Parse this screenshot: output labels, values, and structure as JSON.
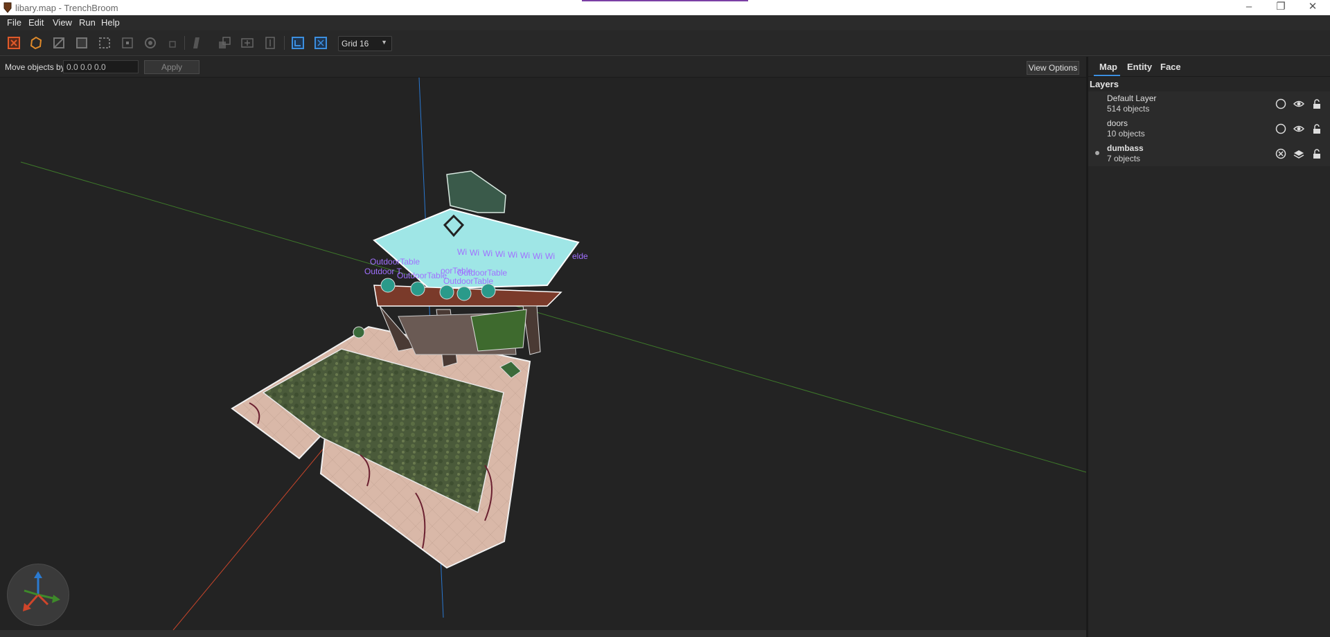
{
  "window": {
    "title": "libary.map - TrenchBroom",
    "min_label": "–",
    "max_label": "❐",
    "close_label": "✕"
  },
  "menu": {
    "items": [
      "File",
      "Edit",
      "View",
      "Run",
      "Help"
    ]
  },
  "toolbar": {
    "tools": [
      "select-tool-icon",
      "vertex-tool-icon",
      "edge-tool-icon",
      "face-tool-icon",
      "rotate-tool-icon",
      "scale-tool-icon",
      "shear-tool-icon",
      "clip-tool-icon",
      "csg-convex-merge-icon",
      "csg-subtract-icon",
      "csg-intersect-icon",
      "csg-hollow-icon",
      "texture-lock-icon",
      "uv-lock-icon"
    ],
    "grid_select": "Grid 16"
  },
  "movebar": {
    "label": "Move objects by",
    "value": "0.0 0.0 0.0",
    "apply_label": "Apply",
    "view_options_label": "View Options"
  },
  "viewport": {
    "entity_labels": [
      "Outdoor T",
      "OutdoorTable",
      "OutdoorTable",
      "OutdoorTable",
      "OutdoorTable",
      "oorTable",
      "Wi",
      "Wi",
      "Wi",
      "Wi",
      "Wi",
      "Wi",
      "Wi",
      "Wi",
      "elde"
    ]
  },
  "panel": {
    "tabs": [
      "Map",
      "Entity",
      "Face"
    ],
    "active_tab": "Map",
    "layers_title": "Layers",
    "layers": [
      {
        "name": "Default Layer",
        "count": "514 objects",
        "current": false,
        "bold": false
      },
      {
        "name": "doors",
        "count": "10 objects",
        "current": false,
        "bold": false
      },
      {
        "name": "dumbass",
        "count": "7 objects",
        "current": true,
        "bold": true
      }
    ]
  },
  "colors": {
    "background": "#232323",
    "panel": "#262626",
    "accent": "#3c8fe0",
    "axis_x": "#d0452a",
    "axis_y": "#3e8a2a",
    "axis_z": "#2a7ad0"
  }
}
